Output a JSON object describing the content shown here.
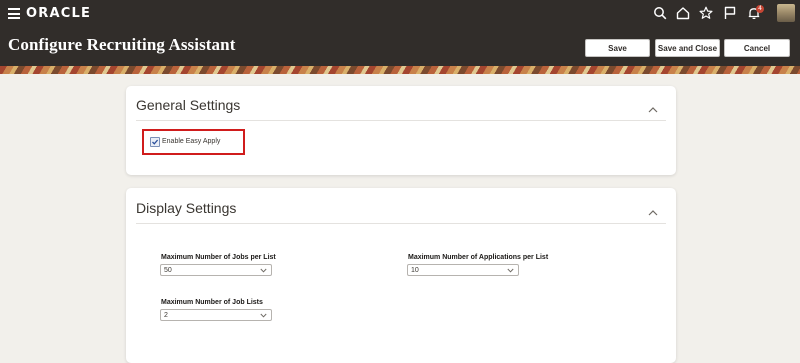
{
  "header": {
    "brand": "ORACLE",
    "notification_count": "4",
    "page_title": "Configure Recruiting Assistant",
    "buttons": {
      "save": "Save",
      "save_and_close": "Save and Close",
      "cancel": "Cancel"
    },
    "icons": [
      "menu-icon",
      "search-icon",
      "home-icon",
      "star-icon",
      "flag-icon",
      "bell-icon",
      "user-avatar"
    ]
  },
  "general_settings": {
    "title": "General Settings",
    "enable_easy_apply": {
      "label": "Enable Easy Apply",
      "checked": true
    }
  },
  "display_settings": {
    "title": "Display Settings",
    "fields": {
      "max_jobs_per_list": {
        "label": "Maximum Number of Jobs per List",
        "value": "50"
      },
      "max_applications_per_list": {
        "label": "Maximum Number of Applications per List",
        "value": "10"
      },
      "max_job_lists": {
        "label": "Maximum Number of Job Lists",
        "value": "2"
      }
    }
  },
  "colors": {
    "header_bg": "#312d2a",
    "page_bg": "#f2f0eb",
    "highlight": "#d01c1c",
    "badge": "#c74634"
  }
}
